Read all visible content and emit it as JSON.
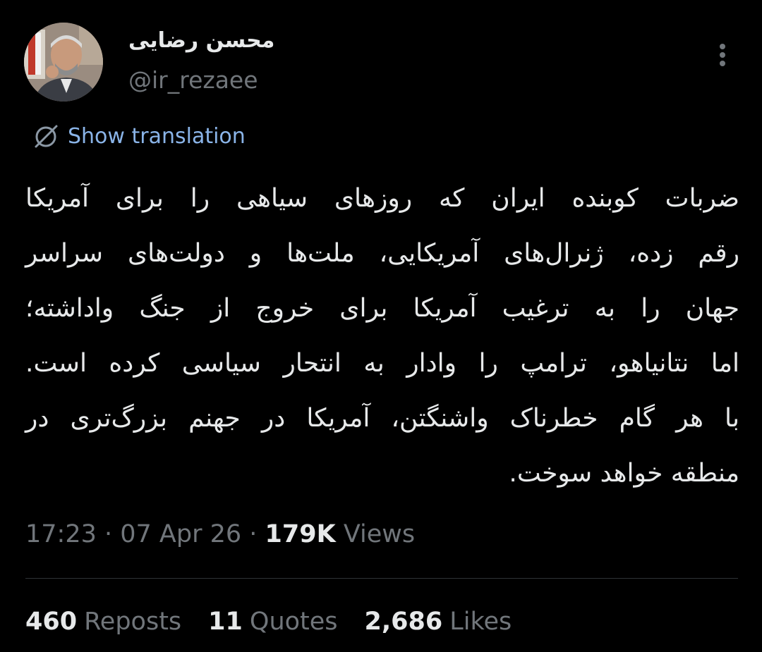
{
  "author": {
    "display_name": "محسن رضایی",
    "handle": "@ir_rezaee",
    "avatar_icon": "profile-photo"
  },
  "menu": {
    "icon": "more-vertical-icon"
  },
  "translation": {
    "label": "Show translation",
    "icon": "globe-slash-icon",
    "color": "#8ab4e8"
  },
  "tweet": {
    "lines": [
      "ضربات کوبنده ایران که روزهای سیاهی را برای آمریکا",
      "رقم زده، ژنرال‌های آمریکایی، ملت‌ها و دولت‌های سراسر",
      "جهان را به ترغیب آمریکا برای خروج از جنگ واداشته؛",
      "اما نتانیاهو، ترامپ را وادار به انتحار سیاسی کرده است.",
      "با هر گام خطرناک واشنگتن، آمریکا در جهنم بزرگ‌تری در",
      "منطقه خواهد سوخت."
    ]
  },
  "meta": {
    "time": "17:23",
    "separator": " · ",
    "date": "07 Apr 26",
    "views_count": "179K",
    "views_label": " Views"
  },
  "stats": {
    "reposts_count": "460",
    "reposts_label": "Reposts",
    "quotes_count": "11",
    "quotes_label": "Quotes",
    "likes_count": "2,686",
    "likes_label": "Likes"
  },
  "colors": {
    "background": "#000000",
    "primary_text": "#e7e9ea",
    "secondary_text": "#71767b",
    "divider": "#2f3336"
  }
}
